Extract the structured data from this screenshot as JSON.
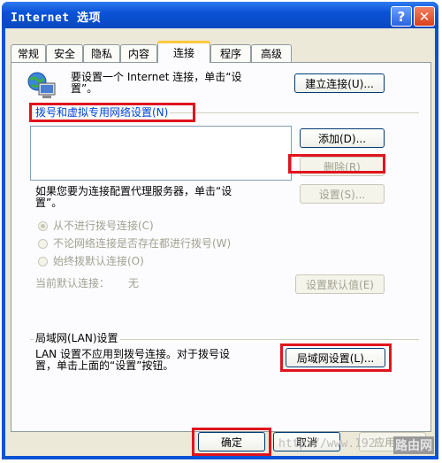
{
  "window": {
    "title": "Internet 选项"
  },
  "titlebar": {
    "help": "?",
    "close": "✕"
  },
  "tabs": [
    {
      "label": "常规"
    },
    {
      "label": "安全"
    },
    {
      "label": "隐私"
    },
    {
      "label": "内容"
    },
    {
      "label": "连接"
    },
    {
      "label": "程序"
    },
    {
      "label": "高级"
    }
  ],
  "setup": {
    "text_line1": "要设置一个 Internet 连接，单击“设",
    "text_line2": "置”。",
    "button": "建立连接(U)..."
  },
  "dialup": {
    "header": "拨号和虚拟专用网络设置(N)",
    "add_button": "添加(D)...",
    "remove_button": "删除(R)",
    "settings_button": "设置(S)...",
    "proxy_text_line1": "如果您要为连接配置代理服务器，单击“设",
    "proxy_text_line2": "置”。",
    "radio_never": "从不进行拨号连接(C)",
    "radio_no_network": "不论网络连接是否存在都进行拨号(W)",
    "radio_always": "始终拨默认连接(O)",
    "current_default_label": "当前默认连接：",
    "current_default_value": "无",
    "set_default_button": "设置默认值(E)"
  },
  "lan": {
    "header": "局域网(LAN)设置",
    "text_line1": "LAN 设置不应用到拨号连接。对于拨号设",
    "text_line2": "置，单击上面的“设置”按钮。",
    "button": "局域网设置(L)..."
  },
  "footer": {
    "ok": "确定",
    "cancel": "取消",
    "apply": "应用(A)"
  },
  "watermark": {
    "url": "http://www.192",
    "logo": "路由网"
  }
}
